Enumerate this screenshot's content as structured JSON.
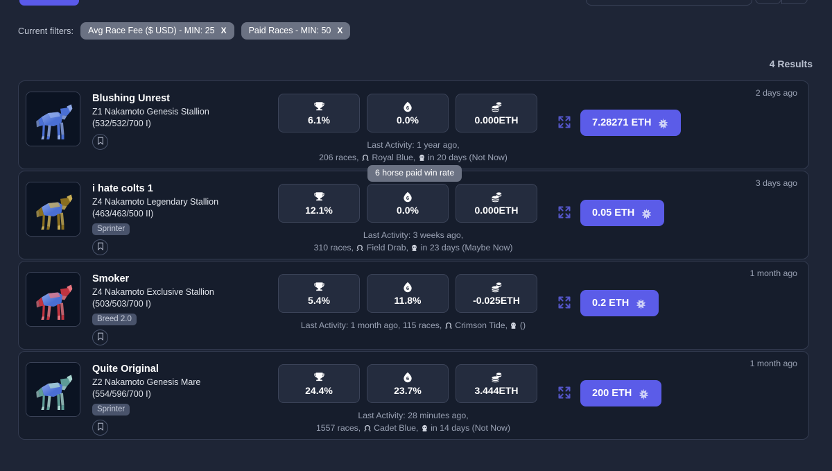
{
  "filters": {
    "label": "Current filters:",
    "chips": [
      {
        "text": "Avg Race Fee ($ USD) - MIN: 25",
        "remove": "X"
      },
      {
        "text": "Paid Races - MIN: 50",
        "remove": "X"
      }
    ]
  },
  "results": {
    "count_label": "4 Results"
  },
  "tooltip": {
    "text": "6 horse paid win rate"
  },
  "colors": {
    "accent": "#5b5ce8",
    "page_bg": "#1e2536",
    "card_bg": "#161d2c",
    "card_border": "#333b50",
    "stat_bg": "#242c3e",
    "chip_bg": "#6b7283",
    "muted_text": "#99a1b3"
  },
  "icon_names": {
    "win_rate": "trophy-icon",
    "paid_win_rate": "six-droplet-icon",
    "earnings": "coin-stack-icon",
    "expand": "expand-arrows-icon",
    "bookmark": "bookmark-icon",
    "brand": "zed-star-icon",
    "bloodline": "horseshoe-icon",
    "breeding": "foal-icon"
  },
  "cards": [
    {
      "name": "Blushing Unrest",
      "subtitle": "Z1 Nakamoto Genesis Stallion",
      "genotype": "(532/532/700 I)",
      "tag": null,
      "coat": "#4a6fd4",
      "coat2": "#8fa9e8",
      "stats": [
        {
          "icon": "trophy-icon",
          "value": "6.1%"
        },
        {
          "icon": "six-droplet-icon",
          "value": "0.0%"
        },
        {
          "icon": "coin-stack-icon",
          "value": "0.000ETH"
        }
      ],
      "activity_line1": "Last Activity: 1 year ago,",
      "activity_line2_pre": "206 races,",
      "activity_bloodline": "Royal Blue,",
      "activity_breeding": "in 20 days (Not Now)",
      "timestamp": "2 days ago",
      "price": "7.28271 ETH"
    },
    {
      "name": "i hate colts 1",
      "subtitle": "Z4 Nakamoto Legendary Stallion",
      "genotype": "(463/463/500 II)",
      "tag": "Sprinter",
      "coat": "#8a6f20",
      "coat2": "#c9ae55",
      "stats": [
        {
          "icon": "trophy-icon",
          "value": "12.1%"
        },
        {
          "icon": "six-droplet-icon",
          "value": "0.0%"
        },
        {
          "icon": "coin-stack-icon",
          "value": "0.000ETH"
        }
      ],
      "activity_line1": "Last Activity: 3 weeks ago,",
      "activity_line2_pre": "310 races,",
      "activity_bloodline": "Field Drab,",
      "activity_breeding": "in 23 days (Maybe Now)",
      "timestamp": "3 days ago",
      "price": "0.05 ETH"
    },
    {
      "name": "Smoker",
      "subtitle": "Z4 Nakamoto Exclusive Stallion",
      "genotype": "(503/503/700 I)",
      "tag": "Breed 2.0",
      "coat": "#c03440",
      "coat2": "#e8757f",
      "stats": [
        {
          "icon": "trophy-icon",
          "value": "5.4%"
        },
        {
          "icon": "six-droplet-icon",
          "value": "11.8%"
        },
        {
          "icon": "coin-stack-icon",
          "value": "-0.025ETH"
        }
      ],
      "activity_line1": "Last Activity: 1 month ago, 115 races,",
      "activity_line2_pre": "",
      "activity_bloodline": "Crimson Tide,",
      "activity_breeding": "()",
      "single_line": true,
      "timestamp": "1 month ago",
      "price": "0.2 ETH"
    },
    {
      "name": "Quite Original",
      "subtitle": "Z2 Nakamoto Genesis Mare",
      "genotype": "(554/596/700 I)",
      "tag": "Sprinter",
      "coat": "#5e9c96",
      "coat2": "#a9d6d0",
      "stats": [
        {
          "icon": "trophy-icon",
          "value": "24.4%"
        },
        {
          "icon": "six-droplet-icon",
          "value": "23.7%"
        },
        {
          "icon": "coin-stack-icon",
          "value": "3.444ETH"
        }
      ],
      "activity_line1": "Last Activity: 28 minutes ago,",
      "activity_line2_pre": "1557 races,",
      "activity_bloodline": "Cadet Blue,",
      "activity_breeding": "in 14 days (Not Now)",
      "timestamp": "1 month ago",
      "price": "200 ETH"
    }
  ]
}
